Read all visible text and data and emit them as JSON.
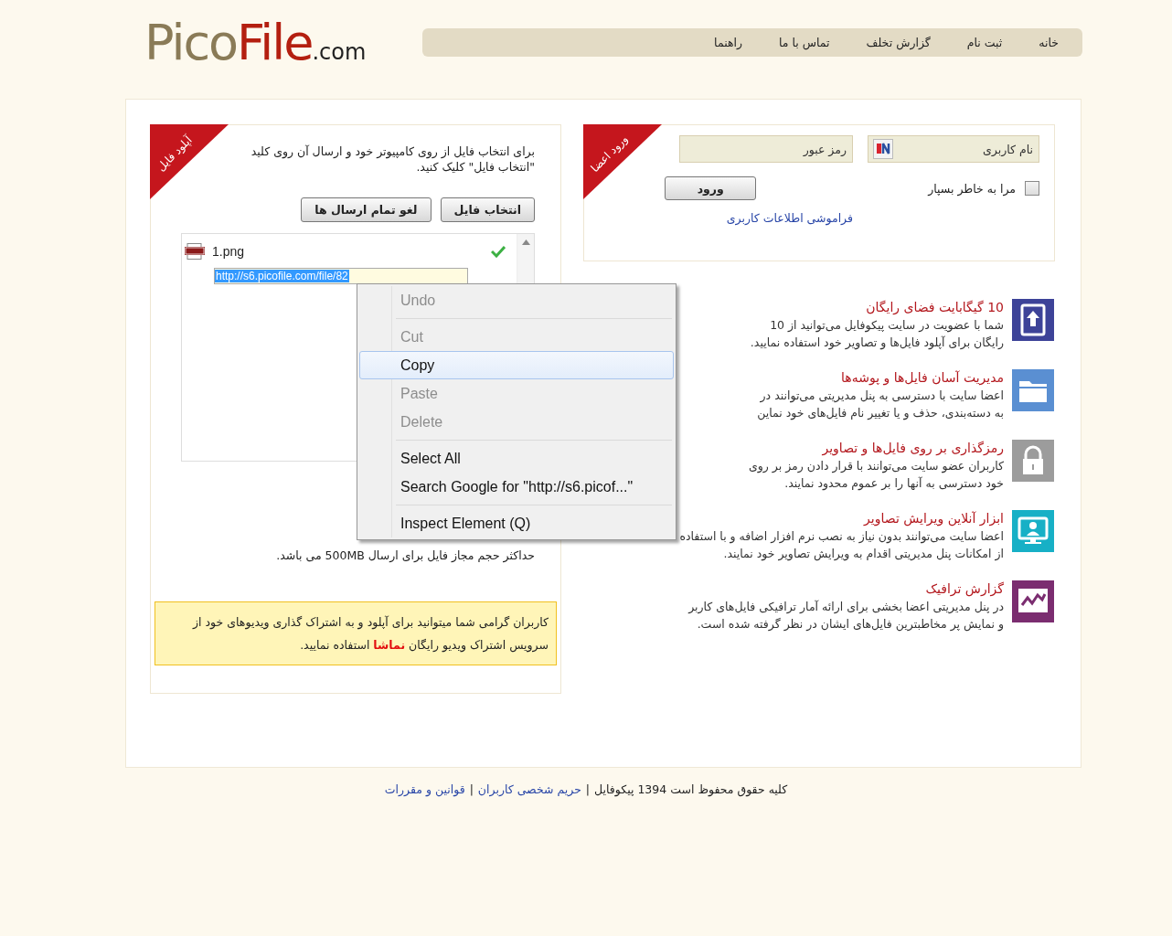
{
  "logo": {
    "part1": "Pico",
    "part2": "File",
    "suffix": ".com"
  },
  "nav": [
    {
      "label": "خانه"
    },
    {
      "label": "ثبت نام"
    },
    {
      "label": "گزارش تخلف"
    },
    {
      "label": "تماس با ما"
    },
    {
      "label": "راهنما"
    }
  ],
  "upload": {
    "ribbon": "آپلود فایل",
    "intro": "برای انتخاب فایل از روی کامپیوتر خود و ارسال آن روی کلید \"انتخاب فایل\" کلیک کنید.",
    "buttons": [
      {
        "label": "انتخاب فایل"
      },
      {
        "label": "لغو تمام ارسال ها"
      }
    ],
    "files": [
      {
        "name": "1.png",
        "done": true,
        "url": "http://s6.picofile.com/file/82",
        "url_selected": true
      }
    ],
    "limit": "حداکثر حجم مجاز فایل برای ارسال 500MB می باشد.",
    "notice": {
      "before": "کاربران گرامی شما میتوانید برای آپلود و به اشتراک گذاری ویدیوهای خود از سرویس اشتراک ویدیو رایگان ",
      "link": "نماشا",
      "after": " استفاده نمایید."
    }
  },
  "login": {
    "ribbon": "ورود اعضا",
    "username": {
      "placeholder": "نام کاربری"
    },
    "password": {
      "placeholder": "رمز عبور"
    },
    "remember": {
      "label": "مرا به خاطر بسپار",
      "checked": false
    },
    "submit": "ورود",
    "forgot": "فراموشی اطلاعات کاربری"
  },
  "features": [
    {
      "title": "10 گیگابایت فضای رایگان",
      "lines": [
        "شما با عضویت در سایت پیکوفایل می‌توانید از 10",
        "رایگان برای آپلود فایل‌ها و تصاویر خود استفاده نمایید."
      ]
    },
    {
      "title": "مدیریت آسان فایل‌ها و پوشه‌ها",
      "lines": [
        "اعضا سایت با دسترسی به پنل مدیریتی می‌توانند در",
        "به دسته‌بندی، حذف و یا تغییر نام فایل‌های خود نماین"
      ]
    },
    {
      "title": "رمزگذاری بر روی فایل‌ها و تصاویر",
      "lines": [
        "کاربران عضو سایت می‌توانند با قرار دادن رمز بر روی",
        "خود دسترسی به آنها را بر عموم محدود نمایند."
      ]
    },
    {
      "title": "ابزار آنلاین ویرایش تصاویر",
      "lines": [
        "اعضا سایت می‌توانند بدون نیاز به نصب نرم افزار اضافه و با استفاده",
        "از امکانات پنل مدیریتی اقدام به ویرایش تصاویر خود نمایند."
      ]
    },
    {
      "title": "گزارش ترافیک",
      "lines": [
        "در پنل مدیریتی اعضا بخشی برای ارائه آمار ترافیکی فایل‌های کاربر",
        "و نمایش پر مخاطبترین فایل‌های ایشان در نظر گرفته شده است."
      ]
    }
  ],
  "footer": [
    {
      "kind": "text",
      "text": "کلیه حقوق محفوظ است 1394 پیکوفایل"
    },
    {
      "kind": "separator",
      "text": "|"
    },
    {
      "kind": "link",
      "text": "حریم شخصی کاربران"
    },
    {
      "kind": "separator",
      "text": "|"
    },
    {
      "kind": "link",
      "text": "قوانین و مقررات"
    }
  ],
  "context_menu": [
    {
      "kind": "item",
      "label": "Undo",
      "disabled": true,
      "selected": false
    },
    {
      "kind": "separator"
    },
    {
      "kind": "item",
      "label": "Cut",
      "disabled": true,
      "selected": false
    },
    {
      "kind": "item",
      "label": "Copy",
      "disabled": false,
      "selected": true
    },
    {
      "kind": "item",
      "label": "Paste",
      "disabled": true,
      "selected": false
    },
    {
      "kind": "item",
      "label": "Delete",
      "disabled": true,
      "selected": false
    },
    {
      "kind": "separator"
    },
    {
      "kind": "item",
      "label": "Select All",
      "disabled": false,
      "selected": false
    },
    {
      "kind": "item",
      "label": "Search Google for \"http://s6.picof...\"",
      "disabled": false,
      "selected": false
    },
    {
      "kind": "separator"
    },
    {
      "kind": "item",
      "label": "Inspect Element (Q)",
      "disabled": false,
      "selected": false
    }
  ]
}
